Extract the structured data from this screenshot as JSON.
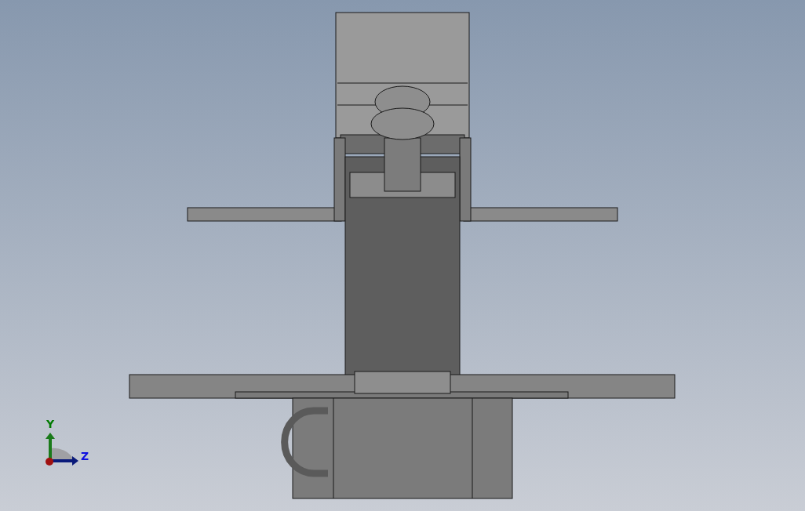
{
  "triad": {
    "axes": [
      {
        "label": "Y",
        "kind": "y"
      },
      {
        "label": "Z",
        "kind": "z"
      }
    ]
  }
}
